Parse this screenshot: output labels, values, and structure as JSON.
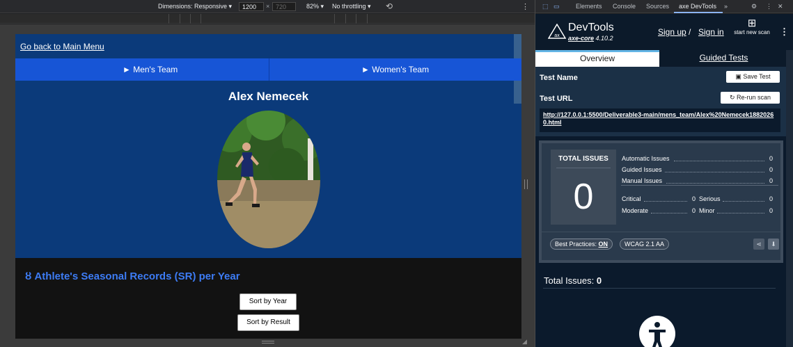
{
  "devtools_toolbar": {
    "dimensions_label": "Dimensions: Responsive ▾",
    "width_value": "1200",
    "times": "×",
    "height_placeholder": "720",
    "zoom_label": "82% ▾",
    "throttle_label": "No throttling ▾",
    "rotate_icon": "rotate-icon",
    "more_icon": "kebab-icon"
  },
  "devtools_tabs": {
    "inspect_icon": "inspect-icon",
    "device_icon": "device-toolbar-icon",
    "items": [
      "Elements",
      "Console",
      "Sources",
      "axe DevTools",
      "»"
    ],
    "active": "axe DevTools",
    "settings_icon": "gear-icon",
    "more_icon": "⋮",
    "close_icon": "✕"
  },
  "page": {
    "back_link": "Go back to Main Menu",
    "nav": [
      "► Men's Team",
      "► Women's Team"
    ],
    "athlete_name": "Alex Nemecek",
    "records_icon": "medal-icon",
    "records_heading": "Athlete's Seasonal Records (SR) per Year",
    "sort_buttons": [
      "Sort by Year",
      "Sort by Result"
    ]
  },
  "axe": {
    "title": "DevTools",
    "version_name": "axe-core",
    "version_number": "4.10.2",
    "sign_up": "Sign up",
    "separator": "/",
    "sign_in": "Sign in",
    "start_scan": "start new scan",
    "tabs": [
      "Overview",
      "Guided Tests"
    ],
    "test_name_label": "Test Name",
    "save_test": "Save Test",
    "test_url_label": "Test URL",
    "rerun_scan": "Re-run scan",
    "test_url": "http://127.0.0.1:5500/Deliverable3-main/mens_team/Alex%20Nemecek18820260.html",
    "summary": {
      "total_label": "TOTAL ISSUES",
      "total_value": "0",
      "automatic_label": "Automatic Issues",
      "automatic_value": "0",
      "guided_label": "Guided Issues",
      "guided_value": "0",
      "manual_label": "Manual Issues",
      "manual_value": "0",
      "critical_label": "Critical",
      "critical_value": "0",
      "serious_label": "Serious",
      "serious_value": "0",
      "moderate_label": "Moderate",
      "moderate_value": "0",
      "minor_label": "Minor",
      "minor_value": "0",
      "best_practices_label": "Best Practices:",
      "best_practices_value": "ON",
      "standard": "WCAG 2.1 AA"
    },
    "results_label": "Total Issues:",
    "results_value": "0"
  },
  "colors": {
    "page_blue": "#0b3a7a",
    "nav_blue": "#1755d6",
    "heading_blue": "#3d7cf5",
    "axe_bg": "#0b1a2c",
    "axe_accent": "#62b5e5"
  }
}
